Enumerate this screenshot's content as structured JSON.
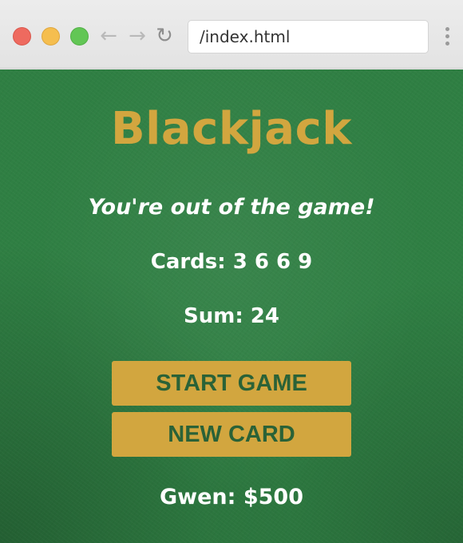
{
  "browser": {
    "address": "/index.html",
    "back_icon": "arrow-left-icon",
    "forward_icon": "arrow-right-icon",
    "reload_icon": "reload-icon",
    "menu_icon": "vertical-dots-icon"
  },
  "game": {
    "title": "Blackjack",
    "message": "You're out of the game!",
    "cards_text": "Cards: 3 6 6 9",
    "sum_text": "Sum: 24",
    "start_button": "START GAME",
    "new_card_button": "NEW CARD",
    "player_text": "Gwen: $500"
  },
  "colors": {
    "felt": "#2f7f43",
    "accent_gold": "#d2a63f",
    "button_text": "#2a6237",
    "text": "#ffffff"
  }
}
